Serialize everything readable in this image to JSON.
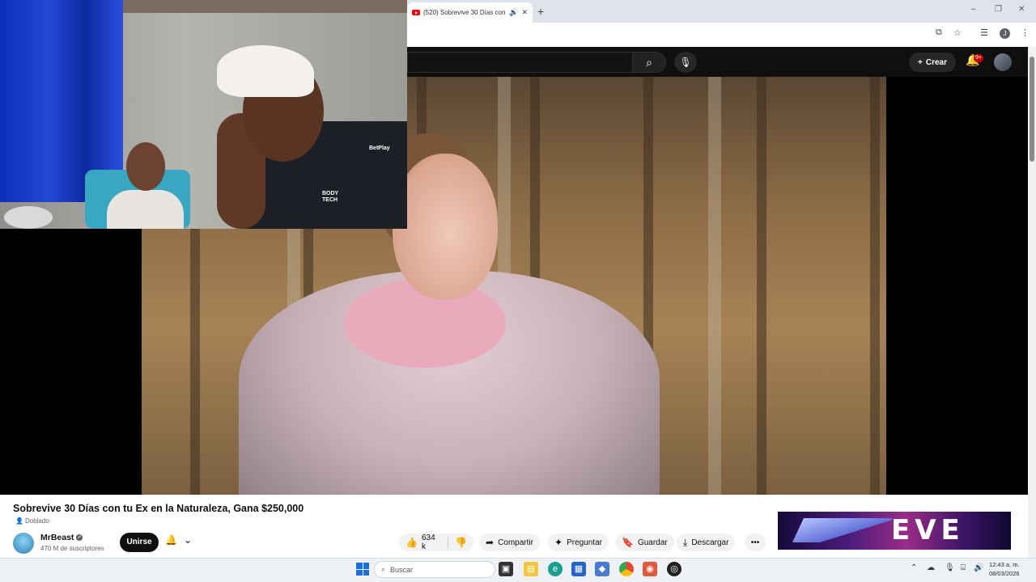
{
  "browser": {
    "tab_title": "(520) Sobrevive 30 Días con",
    "tab_audio_icon": "speaker-icon",
    "tab_close_icon": "close-icon",
    "new_tab_icon": "plus-icon"
  },
  "youtube_header": {
    "create_label": "Crear",
    "notifications_badge": "9+"
  },
  "video": {
    "title": "Sobrevive 30 Días con tu Ex en la Naturaleza, Gana $250,000",
    "dubbed_label": "Doblado"
  },
  "channel": {
    "name": "MrBeast",
    "subscribers": "470 M de suscriptores",
    "join_label": "Unirse"
  },
  "actions": {
    "likes": "634 k",
    "share_label": "Compartir",
    "ask_label": "Preguntar",
    "save_label": "Guardar",
    "download_label": "Descargar"
  },
  "ad": {
    "logo_text": "EVE"
  },
  "webcam_overlay": {
    "jersey_line1": "BetPlay",
    "jersey_line2": "BODY TECH"
  },
  "taskbar": {
    "search_placeholder": "Buscar",
    "time": "12:43 a. m.",
    "date": "08/03/2026"
  }
}
